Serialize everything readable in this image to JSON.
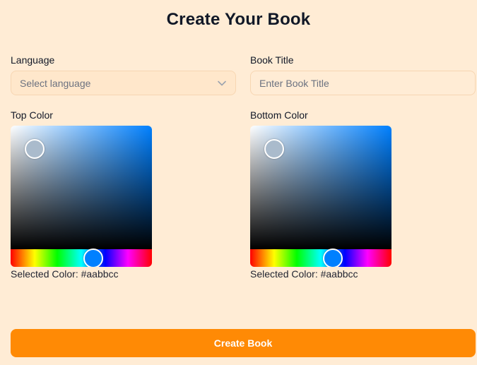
{
  "title": "Create Your Book",
  "language": {
    "label": "Language",
    "placeholder": "Select language",
    "chevron_icon": "chevron-down-icon"
  },
  "book_title": {
    "label": "Book Title",
    "placeholder": "Enter Book Title",
    "value": ""
  },
  "top_color": {
    "label": "Top Color",
    "selected_text": "Selected Color: #aabbcc",
    "value": "#aabbcc"
  },
  "bottom_color": {
    "label": "Bottom Color",
    "selected_text": "Selected Color: #aabbcc",
    "value": "#aabbcc"
  },
  "create_button": {
    "label": "Create Book",
    "color": "#ff8a05"
  },
  "colors": {
    "background": "#ffecd5",
    "accent": "#ff8a05",
    "hue_blue": "#0080ff"
  }
}
